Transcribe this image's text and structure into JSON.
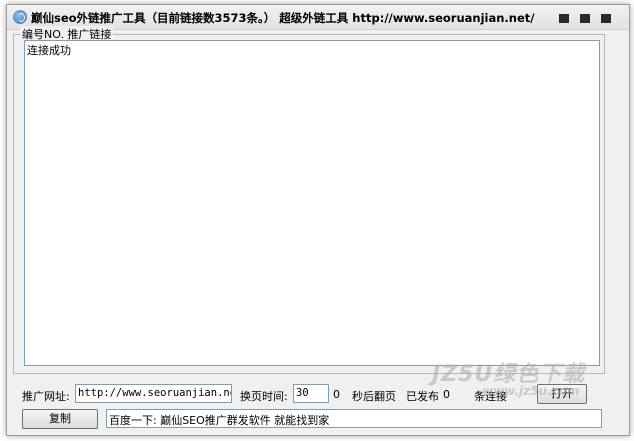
{
  "titlebar": {
    "title": "巅仙seo外链推广工具（目前链接数3573条。）  超级外链工具    http://www.seoruanjian.net/",
    "controls": [
      "minimize-icon",
      "maximize-icon",
      "close-icon"
    ]
  },
  "group": {
    "label": "编号NO. 推广链接"
  },
  "log": {
    "text": "连接成功"
  },
  "controls_row": {
    "url_label": "推广网址:",
    "url_value": "http://www.seoruanjian.net/",
    "interval_label": "换页时间:",
    "interval_value": "30",
    "zero": "0",
    "suffix_label": "秒后翻页",
    "published_label": "已发布",
    "published_count": "0",
    "links_label": "条连接",
    "open_button": "打开"
  },
  "bottom_row": {
    "copy_button": "复制",
    "promo_text": "百度一下: 巅仙SEO推广群发软件 就能找到家"
  },
  "watermark": {
    "main": "JZ5U绿色下载",
    "sub": "www.jz5u.com"
  },
  "colors": {
    "window_bg": "#f0f0f0",
    "input_border": "#7f9db9"
  }
}
